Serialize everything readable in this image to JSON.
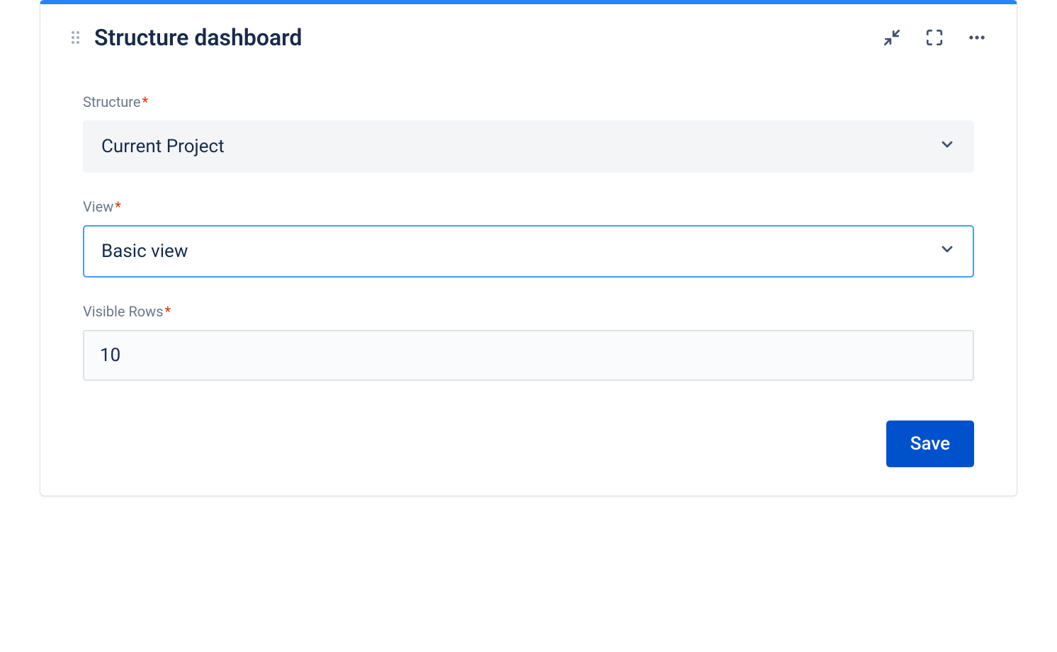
{
  "header": {
    "title": "Structure dashboard"
  },
  "form": {
    "structure": {
      "label": "Structure",
      "required": true,
      "value": "Current Project"
    },
    "view": {
      "label": "View",
      "required": true,
      "value": "Basic view",
      "focused": true
    },
    "visibleRows": {
      "label": "Visible Rows",
      "required": true,
      "value": "10"
    }
  },
  "actions": {
    "save_label": "Save"
  },
  "colors": {
    "accent": "#2684ff",
    "primary_button": "#0052cc",
    "text": "#172b4d",
    "label": "#6b778c",
    "required": "#de350b"
  }
}
